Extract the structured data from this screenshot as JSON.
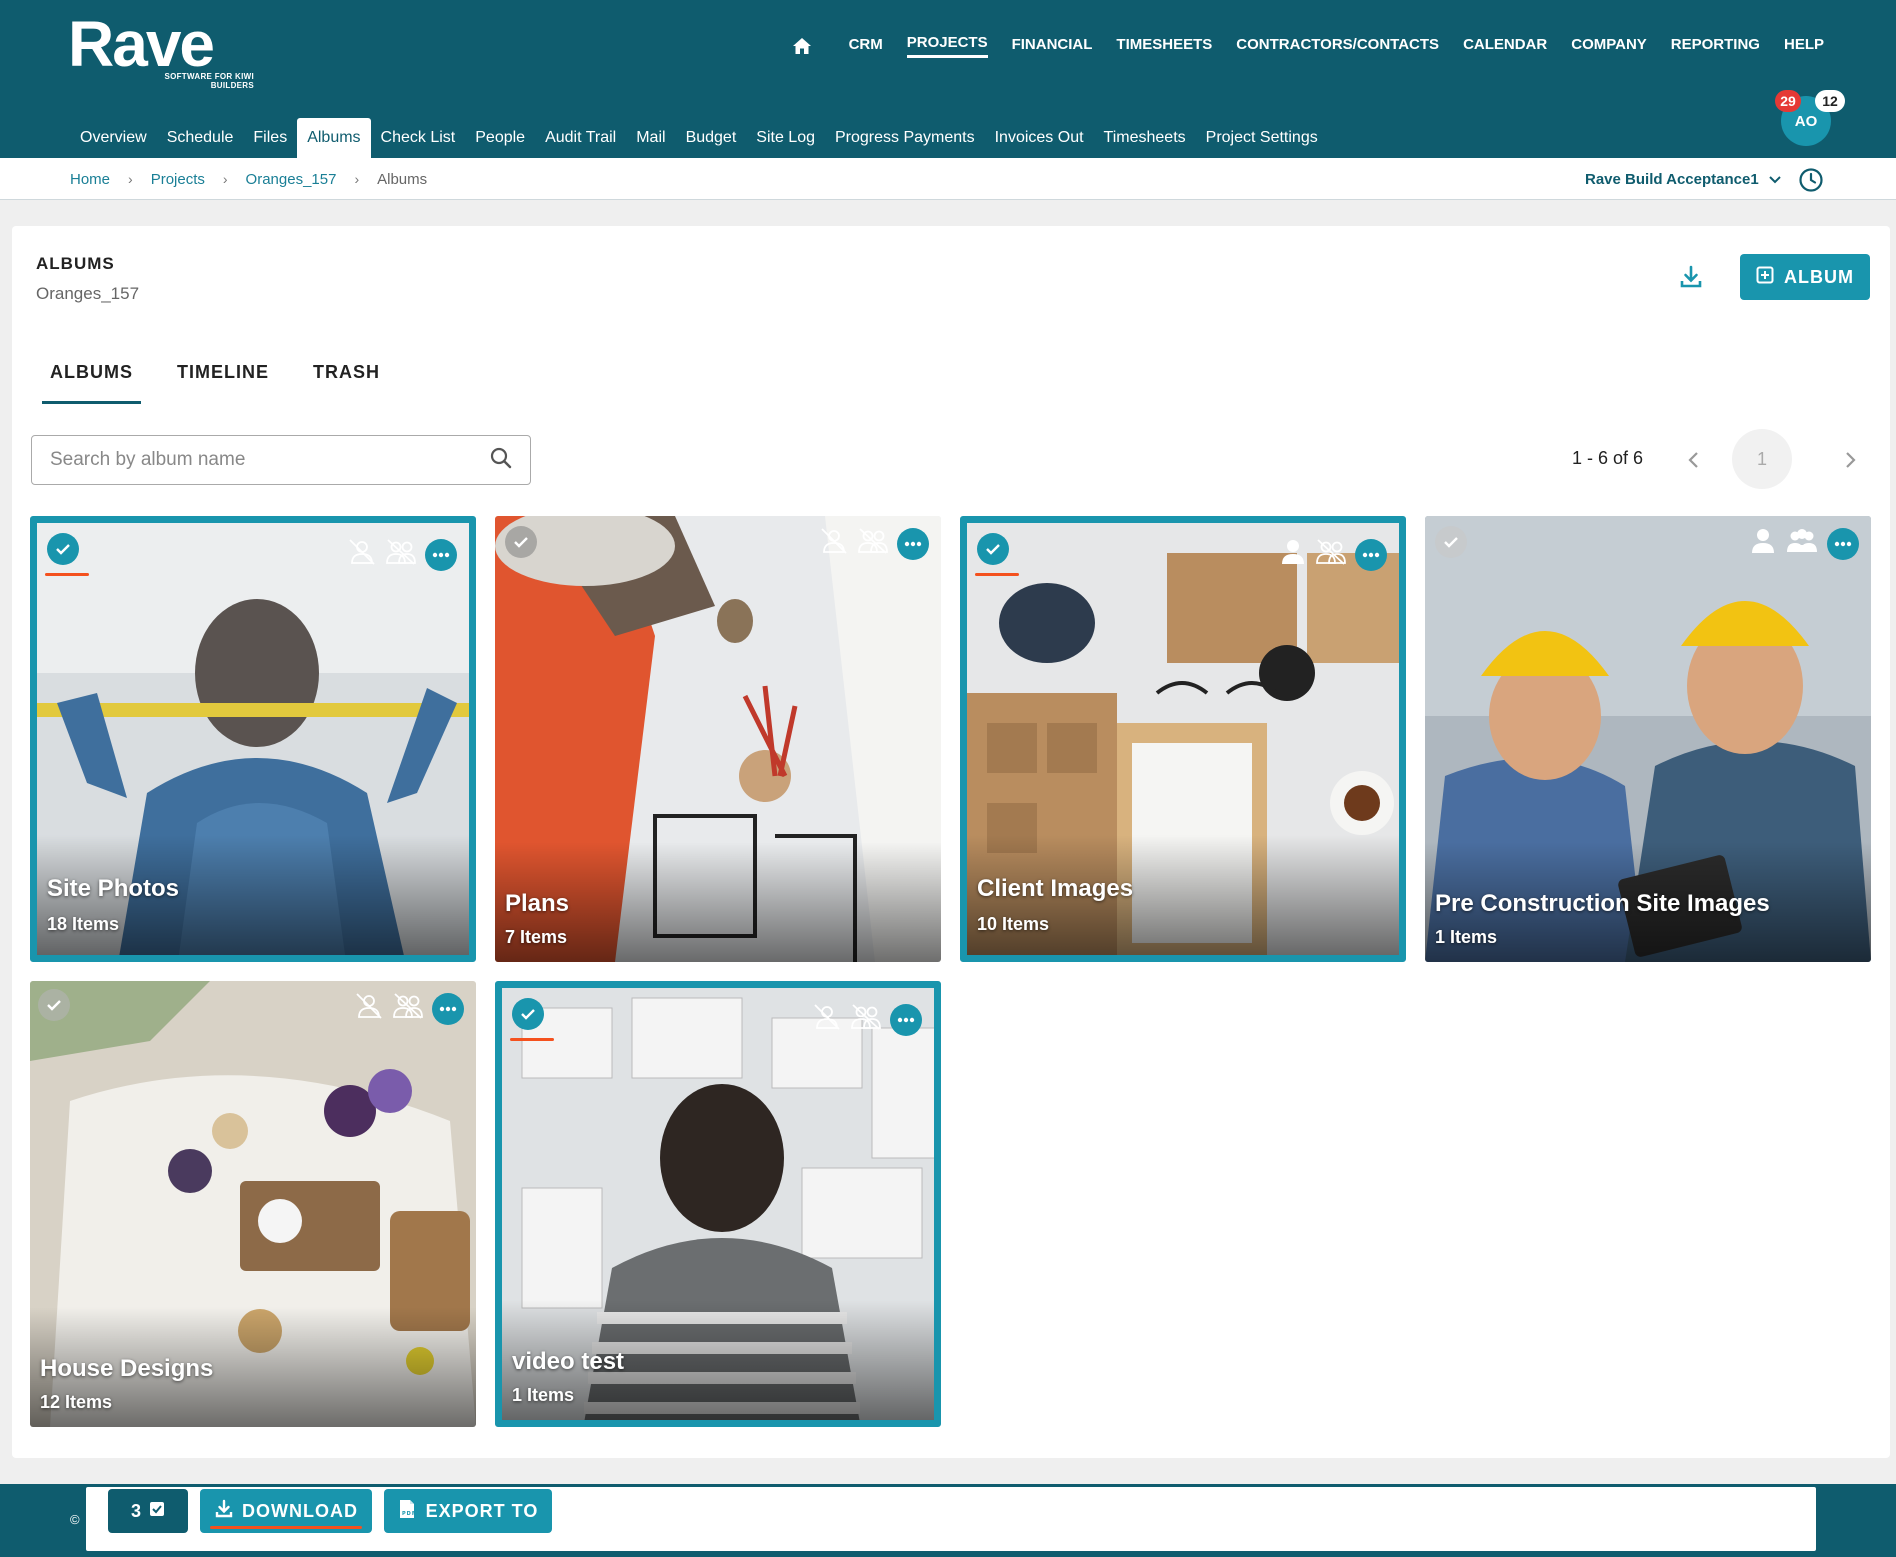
{
  "app": {
    "logo": "Rave",
    "logo_tagline": "SOFTWARE FOR KIWI BUILDERS"
  },
  "top_nav": [
    "CRM",
    "PROJECTS",
    "FINANCIAL",
    "TIMESHEETS",
    "CONTRACTORS/CONTACTS",
    "CALENDAR",
    "COMPANY",
    "REPORTING",
    "HELP"
  ],
  "top_nav_active": "PROJECTS",
  "sub_nav": [
    "Overview",
    "Schedule",
    "Files",
    "Albums",
    "Check List",
    "People",
    "Audit Trail",
    "Mail",
    "Budget",
    "Site Log",
    "Progress Payments",
    "Invoices Out",
    "Timesheets",
    "Project Settings"
  ],
  "sub_nav_active": "Albums",
  "user": {
    "initials": "AO",
    "notifications": "29",
    "messages": "12"
  },
  "breadcrumb": {
    "home": "Home",
    "projects": "Projects",
    "project": "Oranges_157",
    "current": "Albums"
  },
  "company_selector": "Rave Build Acceptance1",
  "page": {
    "title": "ALBUMS",
    "subtitle": "Oranges_157",
    "add_button": "ALBUM"
  },
  "tabs": [
    "ALBUMS",
    "TIMELINE",
    "TRASH"
  ],
  "tabs_active": "ALBUMS",
  "search": {
    "placeholder": "Search by album name"
  },
  "pagination": {
    "range": "1 - 6 of 6",
    "page": "1"
  },
  "albums": [
    {
      "name": "Site Photos",
      "count": "18 Items",
      "selected": true,
      "client_visible": false,
      "contractor_visible": false
    },
    {
      "name": "Plans",
      "count": "7 Items",
      "selected": false,
      "client_visible": false,
      "contractor_visible": false
    },
    {
      "name": "Client Images",
      "count": "10 Items",
      "selected": true,
      "client_visible": true,
      "contractor_visible": false
    },
    {
      "name": "Pre Construction Site Images",
      "count": "1 Items",
      "selected": false,
      "client_visible": true,
      "contractor_visible": true
    },
    {
      "name": "House Designs",
      "count": "12 Items",
      "selected": false,
      "client_visible": false,
      "contractor_visible": false
    },
    {
      "name": "video test",
      "count": "1 Items",
      "selected": true,
      "client_visible": false,
      "contractor_visible": false
    }
  ],
  "action_bar": {
    "selected_count": "3",
    "download": "DOWNLOAD",
    "export": "EXPORT TO"
  },
  "footer": {
    "copyright": "©"
  },
  "colors": {
    "header": "#0f5c6e",
    "accent": "#1995ad",
    "highlight": "#f4511e",
    "badge": "#e53935"
  }
}
